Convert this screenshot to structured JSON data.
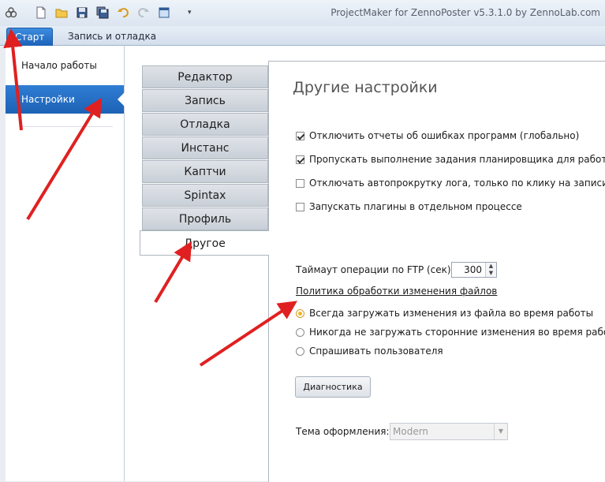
{
  "window": {
    "title": "ProjectMaker for ZennoPoster v5.3.1.0 by ZennoLab.com"
  },
  "ribbon": {
    "tabs": [
      {
        "label": "Старт",
        "active": true
      },
      {
        "label": "Запись и отладка",
        "active": false
      }
    ]
  },
  "sidebar": {
    "items": [
      {
        "label": "Начало работы",
        "selected": false
      },
      {
        "label": "Настройки",
        "selected": true
      }
    ]
  },
  "settings": {
    "tabs": [
      "Редактор",
      "Запись",
      "Отладка",
      "Инстанс",
      "Каптчи",
      "Spintax",
      "Профиль",
      "Другое"
    ],
    "active_tab": "Другое",
    "panel_title": "Другие настройки",
    "checkboxes": [
      {
        "label": "Отключить отчеты об ошибках программ (глобально)",
        "checked": true
      },
      {
        "label": "Пропускать выполнение задания планировщика для работающ",
        "checked": true
      },
      {
        "label": "Отключать автопрокрутку лога, только по клику на записи в ло",
        "checked": false
      },
      {
        "label": "Запускать плагины в отдельном процессе",
        "checked": false
      }
    ],
    "ftp_timeout_label": "Таймаут операции по FTP (сек):",
    "ftp_timeout_value": "300",
    "policy_label": "Политика обработки изменения файлов",
    "radios": [
      {
        "label": "Всегда загружать изменения из файла во время работы",
        "selected": true
      },
      {
        "label": "Никогда не загружать сторонние изменения во время работы",
        "selected": false
      },
      {
        "label": "Спрашивать пользователя",
        "selected": false
      }
    ],
    "diagnostics_button": "Диагностика",
    "theme_label": "Тема оформления:",
    "theme_value": "Modern"
  },
  "colors": {
    "accent": "#1d62b5",
    "annotation_arrow": "#e02020"
  }
}
